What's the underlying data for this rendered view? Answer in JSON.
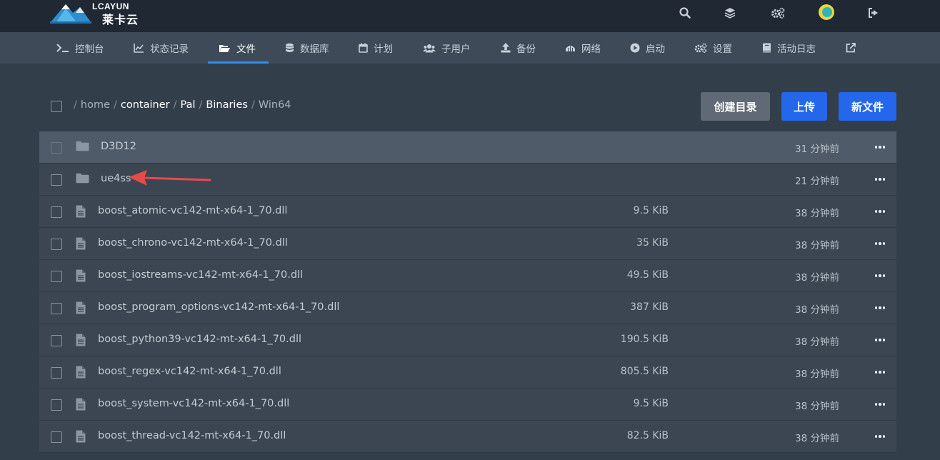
{
  "brand": {
    "name_en": "LCAYUN",
    "name_cn": "莱卡云"
  },
  "topbar": {
    "icons": [
      "search-icon",
      "layers-icon",
      "cogs-icon",
      "user-avatar",
      "sign-out-icon"
    ]
  },
  "nav": {
    "items": [
      {
        "label": "控制台",
        "icon": "terminal-icon"
      },
      {
        "label": "状态记录",
        "icon": "chart-line-icon"
      },
      {
        "label": "文件",
        "icon": "folder-open-icon",
        "active": true
      },
      {
        "label": "数据库",
        "icon": "database-icon"
      },
      {
        "label": "计划",
        "icon": "calendar-icon"
      },
      {
        "label": "子用户",
        "icon": "users-icon"
      },
      {
        "label": "备份",
        "icon": "upload-icon"
      },
      {
        "label": "网络",
        "icon": "network-icon"
      },
      {
        "label": "启动",
        "icon": "play-circle-icon"
      },
      {
        "label": "设置",
        "icon": "cogs-icon"
      },
      {
        "label": "活动日志",
        "icon": "book-icon"
      },
      {
        "label": "",
        "icon": "external-link-icon"
      }
    ]
  },
  "breadcrumb": {
    "segments": [
      "home",
      "container",
      "Pal",
      "Binaries",
      "Win64"
    ]
  },
  "toolbar": {
    "create_dir_label": "创建目录",
    "upload_label": "上传",
    "new_file_label": "新文件"
  },
  "files": [
    {
      "type": "folder",
      "name": "D3D12",
      "size": "",
      "modified": "31 分钟前"
    },
    {
      "type": "folder",
      "name": "ue4ss",
      "size": "",
      "modified": "21 分钟前"
    },
    {
      "type": "file",
      "name": "boost_atomic-vc142-mt-x64-1_70.dll",
      "size": "9.5 KiB",
      "modified": "38 分钟前"
    },
    {
      "type": "file",
      "name": "boost_chrono-vc142-mt-x64-1_70.dll",
      "size": "35 KiB",
      "modified": "38 分钟前"
    },
    {
      "type": "file",
      "name": "boost_iostreams-vc142-mt-x64-1_70.dll",
      "size": "49.5 KiB",
      "modified": "38 分钟前"
    },
    {
      "type": "file",
      "name": "boost_program_options-vc142-mt-x64-1_70.dll",
      "size": "387 KiB",
      "modified": "38 分钟前"
    },
    {
      "type": "file",
      "name": "boost_python39-vc142-mt-x64-1_70.dll",
      "size": "190.5 KiB",
      "modified": "38 分钟前"
    },
    {
      "type": "file",
      "name": "boost_regex-vc142-mt-x64-1_70.dll",
      "size": "805.5 KiB",
      "modified": "38 分钟前"
    },
    {
      "type": "file",
      "name": "boost_system-vc142-mt-x64-1_70.dll",
      "size": "9.5 KiB",
      "modified": "38 分钟前"
    },
    {
      "type": "file",
      "name": "boost_thread-vc142-mt-x64-1_70.dll",
      "size": "82.5 KiB",
      "modified": "38 分钟前"
    }
  ],
  "colors": {
    "accent": "#2567ea",
    "annotation_arrow": "#e84a4a"
  }
}
